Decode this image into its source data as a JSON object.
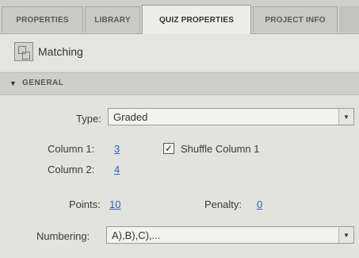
{
  "tabs": [
    {
      "label": "PROPERTIES"
    },
    {
      "label": "LIBRARY"
    },
    {
      "label": "QUIZ PROPERTIES"
    },
    {
      "label": "PROJECT INFO"
    }
  ],
  "active_tab": "QUIZ PROPERTIES",
  "header": {
    "icon": "matching-icon",
    "title": "Matching"
  },
  "section": {
    "expander_icon": "triangle-down-icon",
    "title": "GENERAL"
  },
  "form": {
    "type": {
      "label": "Type:",
      "value": "Graded"
    },
    "column1": {
      "label": "Column 1:",
      "value": "3"
    },
    "shuffle": {
      "label": "Shuffle Column 1",
      "checked": true,
      "check_glyph": "✓"
    },
    "column2": {
      "label": "Column 2:",
      "value": "4"
    },
    "points": {
      "label": "Points:",
      "value": "10"
    },
    "penalty": {
      "label": "Penalty:",
      "value": "0"
    },
    "numbering": {
      "label": "Numbering:",
      "value": "A),B),C),..."
    }
  },
  "colors": {
    "link": "#2f63b0",
    "background": "#e2e2de",
    "tab_active": "#ececea"
  }
}
